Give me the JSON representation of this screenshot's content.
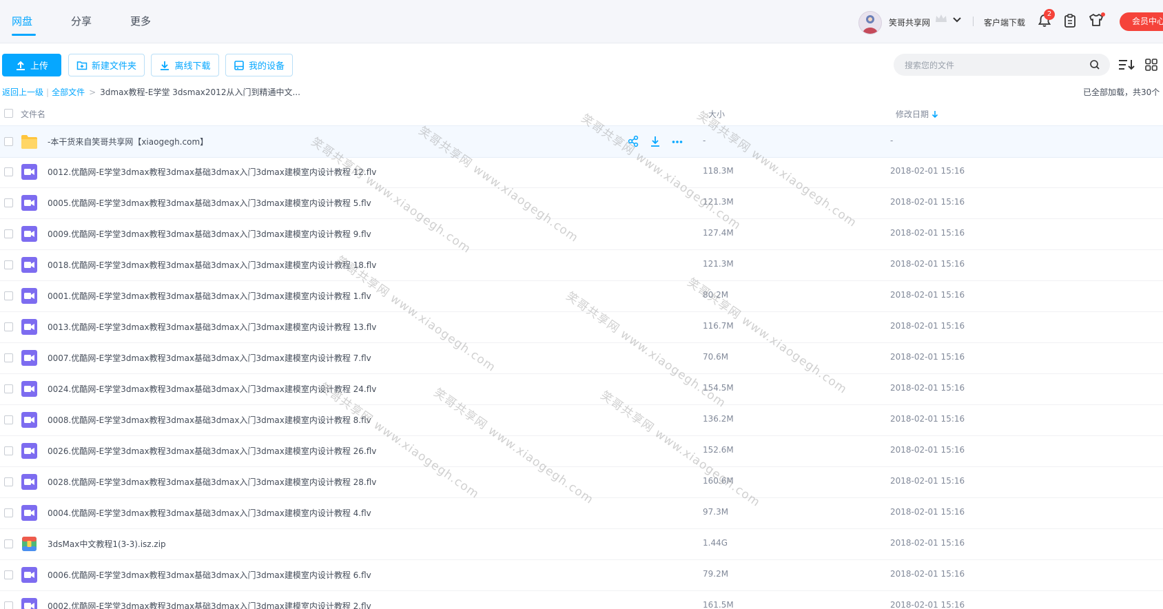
{
  "header": {
    "tabs": [
      {
        "label": "网盘",
        "active": true
      },
      {
        "label": "分享",
        "active": false
      },
      {
        "label": "更多",
        "active": false
      }
    ],
    "user_name": "笑哥共享网",
    "client_download": "客户端下载",
    "notification_count": "2",
    "vip_center": "会员中心"
  },
  "toolbar": {
    "upload": "上传",
    "new_folder": "新建文件夹",
    "offline_download": "离线下载",
    "my_devices": "我的设备",
    "search_placeholder": "搜索您的文件"
  },
  "breadcrumb": {
    "back": "返回上一级",
    "all_files": "全部文件",
    "current": "3dmax教程-E学堂 3dsmax2012从入门到精通中文..."
  },
  "load_status": "已全部加载，共30个",
  "columns": {
    "name": "文件名",
    "size": "大小",
    "modified": "修改日期"
  },
  "files": [
    {
      "type": "folder",
      "name": "-本干货来自笑哥共享网【xiaogegh.com】",
      "size": "-",
      "date": "-"
    },
    {
      "type": "video",
      "name": "0012.优酷网-E学堂3dmax教程3dmax基础3dmax入门3dmax建模室内设计教程 12.flv",
      "size": "118.3M",
      "date": "2018-02-01 15:16"
    },
    {
      "type": "video",
      "name": "0005.优酷网-E学堂3dmax教程3dmax基础3dmax入门3dmax建模室内设计教程 5.flv",
      "size": "121.3M",
      "date": "2018-02-01 15:16"
    },
    {
      "type": "video",
      "name": "0009.优酷网-E学堂3dmax教程3dmax基础3dmax入门3dmax建模室内设计教程 9.flv",
      "size": "127.4M",
      "date": "2018-02-01 15:16"
    },
    {
      "type": "video",
      "name": "0018.优酷网-E学堂3dmax教程3dmax基础3dmax入门3dmax建模室内设计教程 18.flv",
      "size": "121.3M",
      "date": "2018-02-01 15:16"
    },
    {
      "type": "video",
      "name": "0001.优酷网-E学堂3dmax教程3dmax基础3dmax入门3dmax建模室内设计教程 1.flv",
      "size": "80.2M",
      "date": "2018-02-01 15:16"
    },
    {
      "type": "video",
      "name": "0013.优酷网-E学堂3dmax教程3dmax基础3dmax入门3dmax建模室内设计教程 13.flv",
      "size": "116.7M",
      "date": "2018-02-01 15:16"
    },
    {
      "type": "video",
      "name": "0007.优酷网-E学堂3dmax教程3dmax基础3dmax入门3dmax建模室内设计教程 7.flv",
      "size": "70.6M",
      "date": "2018-02-01 15:16"
    },
    {
      "type": "video",
      "name": "0024.优酷网-E学堂3dmax教程3dmax基础3dmax入门3dmax建模室内设计教程 24.flv",
      "size": "154.5M",
      "date": "2018-02-01 15:16"
    },
    {
      "type": "video",
      "name": "0008.优酷网-E学堂3dmax教程3dmax基础3dmax入门3dmax建模室内设计教程 8.flv",
      "size": "136.2M",
      "date": "2018-02-01 15:16"
    },
    {
      "type": "video",
      "name": "0026.优酷网-E学堂3dmax教程3dmax基础3dmax入门3dmax建模室内设计教程 26.flv",
      "size": "152.6M",
      "date": "2018-02-01 15:16"
    },
    {
      "type": "video",
      "name": "0028.优酷网-E学堂3dmax教程3dmax基础3dmax入门3dmax建模室内设计教程 28.flv",
      "size": "160.6M",
      "date": "2018-02-01 15:16"
    },
    {
      "type": "video",
      "name": "0004.优酷网-E学堂3dmax教程3dmax基础3dmax入门3dmax建模室内设计教程 4.flv",
      "size": "97.3M",
      "date": "2018-02-01 15:16"
    },
    {
      "type": "zip",
      "name": "3dsMax中文教程1(3-3).isz.zip",
      "size": "1.44G",
      "date": "2018-02-01 15:16"
    },
    {
      "type": "video",
      "name": "0006.优酷网-E学堂3dmax教程3dmax基础3dmax入门3dmax建模室内设计教程 6.flv",
      "size": "79.2M",
      "date": "2018-02-01 15:16"
    },
    {
      "type": "video",
      "name": "0002.优酷网-E学堂3dmax教程3dmax基础3dmax入门3dmax建模室内设计教程 2.flv",
      "size": "161.5M",
      "date": "2018-02-01 15:16"
    }
  ],
  "watermark": "笑哥共享网 www.xiaogegh.com",
  "colors": {
    "accent": "#06a7ff",
    "vip": "#f5433a",
    "video_icon": "#7d6cf0",
    "folder": "#ffc53d"
  }
}
